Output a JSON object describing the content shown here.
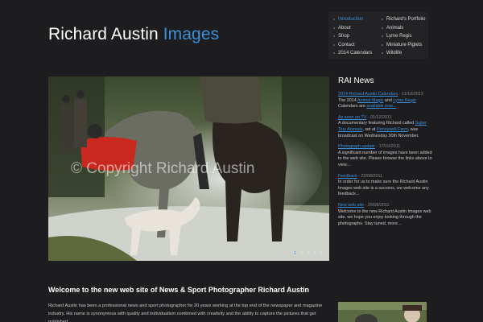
{
  "logo": {
    "main": "Richard Austin",
    "accent": "Images"
  },
  "nav": {
    "col1": [
      {
        "label": "Introduction",
        "active": true
      },
      {
        "label": "About"
      },
      {
        "label": "Shop"
      },
      {
        "label": "Contact"
      },
      {
        "label": "2014 Calendars"
      }
    ],
    "col2": [
      {
        "label": "Richard's Portfolio"
      },
      {
        "label": "Animals"
      },
      {
        "label": "Lyme Regis"
      },
      {
        "label": "Miniature Piglets"
      },
      {
        "label": "Wildlife"
      }
    ]
  },
  "hero": {
    "watermark": "© Copyright Richard Austin",
    "slides": [
      "1",
      "2",
      "3",
      "4",
      "5"
    ],
    "active_slide": 0
  },
  "news": {
    "title": "RAI News",
    "items": [
      {
        "headline": "2014 Richard Austin Calendars",
        "date": "11/10/2013",
        "body_pre": "The 2014 ",
        "link1": "Animal Magic",
        "body_mid": " and ",
        "link2": "Lyme Regis",
        "body_post": " Calendars are ",
        "link3": "available now..."
      },
      {
        "headline": "As seen on TV",
        "date": "01/12/2011",
        "body_pre": "A documentary featuring Richard called ",
        "link1": "Super Tiny Animals",
        "body_mid": ", set at ",
        "link2": "Pennywell Farm",
        "body_post": ", was broadcast on Wednesday 30th November."
      },
      {
        "headline": "Photograph update",
        "date": "17/10/2011",
        "body": "A significant number of images have been added to the web site. Please browse the links above to view...."
      },
      {
        "headline": "Feedback",
        "date": "22/08/2011",
        "body": "In order for us to make sure the Richard Austin Images web site is a success, we welcome any feedback..."
      },
      {
        "headline": "New web site",
        "date": "20/08/2011",
        "body": "Welcome to the new Richard Austin Images web site, we hope you enjoy looking through the photographs. Stay tuned, more..."
      }
    ]
  },
  "welcome": {
    "title": "Welcome to the new web site of News & Sport Photographer Richard Austin",
    "text": "Richard Austin has been a professional news and sport photographer for 20 years working at the top end of the newspaper and magazine industry. His name is synonymous with quality and individualism combined with creativity and the ability to capture the pictures that get published."
  },
  "colors": {
    "accent": "#3b8fd8",
    "background": "#1d1d20"
  }
}
